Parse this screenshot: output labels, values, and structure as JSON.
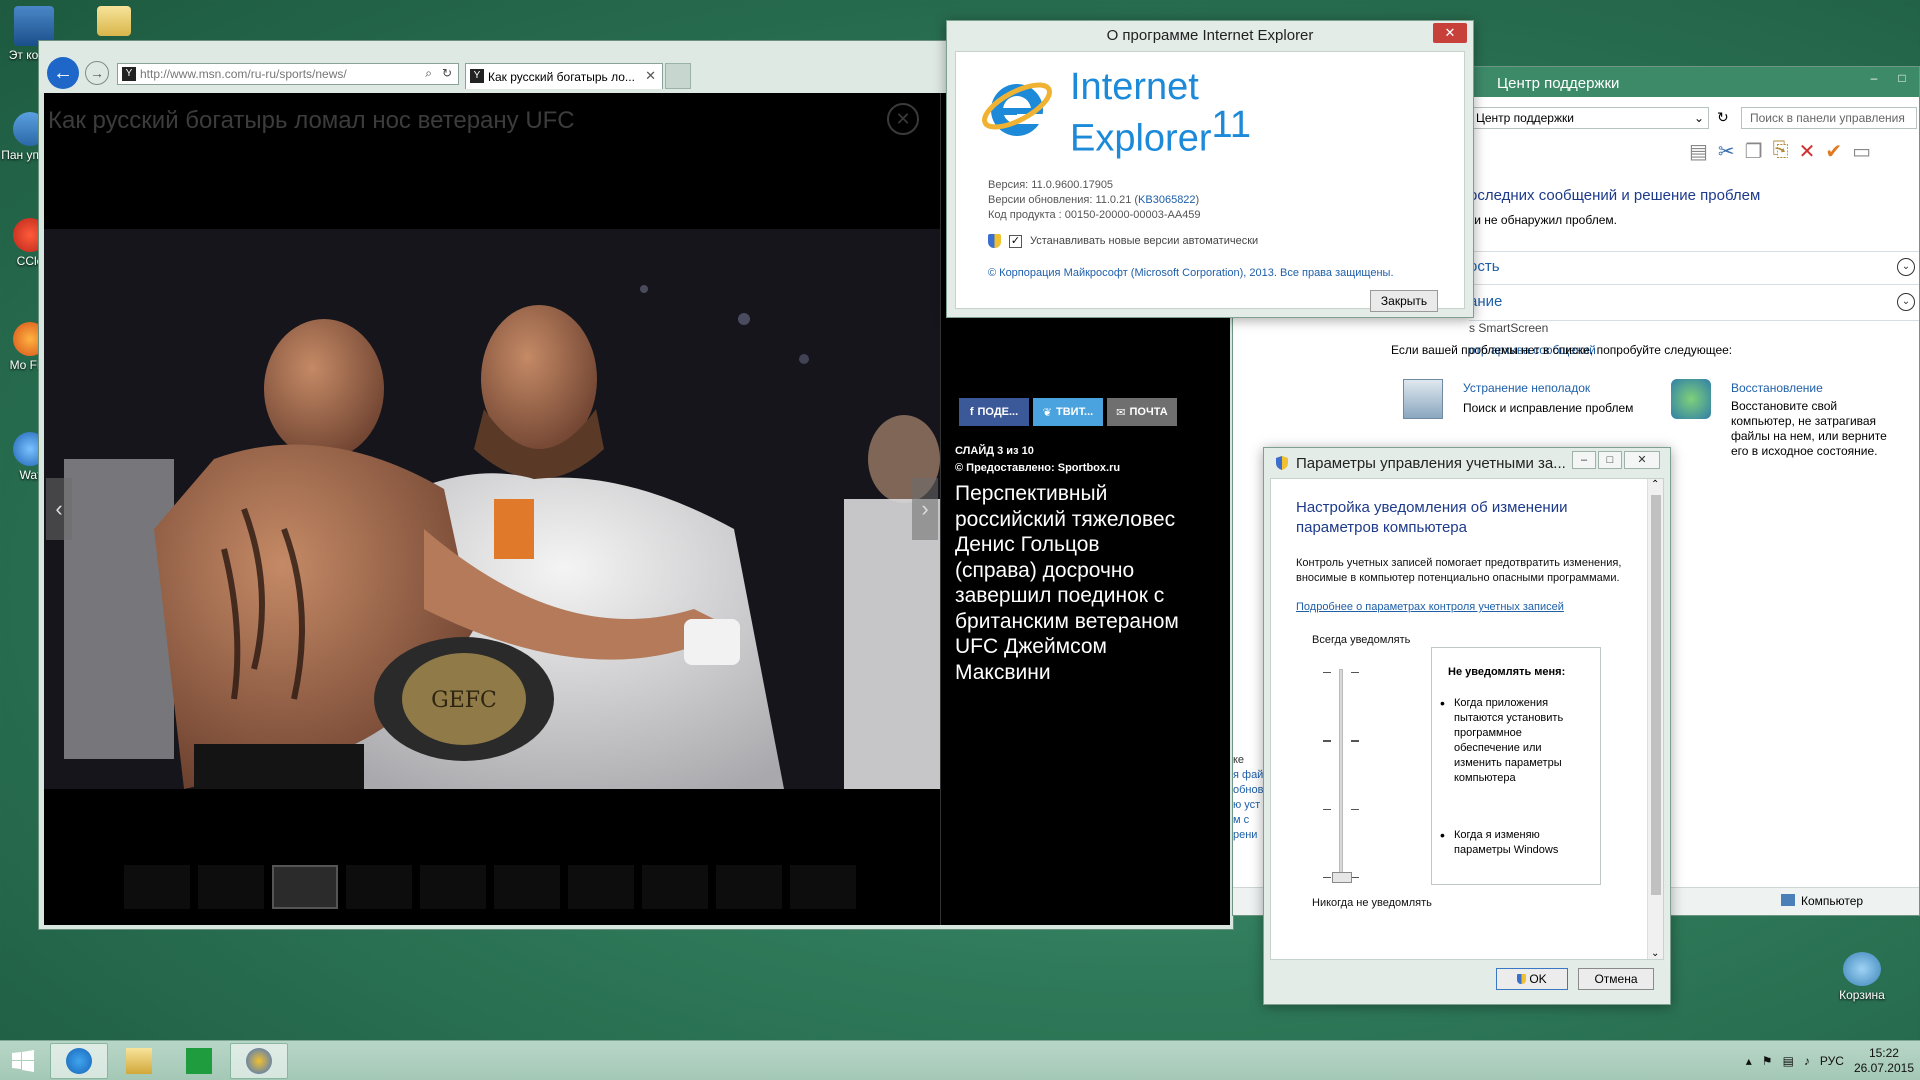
{
  "desktop": {
    "icons": [
      {
        "label": "Эт компь",
        "icon": "computer-icon"
      },
      {
        "label": "Пан управ",
        "icon": "control-panel-icon"
      },
      {
        "label": "CCle",
        "icon": "ccleaner-icon"
      },
      {
        "label": "Mo Fire",
        "icon": "firefox-icon"
      },
      {
        "label": "Wat",
        "icon": "watcher-icon"
      }
    ],
    "recycle_bin": "Корзина"
  },
  "browser": {
    "url": "http://www.msn.com/ru-ru/sports/news/",
    "tab_title": "Как русский богатырь ло...",
    "viewer": {
      "title": "Как русский богатырь ломал нос ветерану UFC",
      "share": {
        "facebook": "ПОДЕ...",
        "twitter": "ТВИТ...",
        "mail": "ПОЧТА"
      },
      "slide_counter": "СЛАЙД 3 из 10",
      "source": "© Предоставлено: Sportbox.ru",
      "caption": "Перспективный российский тяжеловес Денис Гольцов (справа) досрочно завершил поединок с британским ветераном UFC Джеймсом Максвини",
      "thumbnail_count": 10,
      "current_slide": 3,
      "belt_text": "GEFC"
    }
  },
  "about_ie": {
    "title": "О программе Internet Explorer",
    "product_line1": "Internet",
    "product_line2": "Explorer",
    "product_version_badge": "11",
    "version": "Версия: 11.0.9600.17905",
    "update_prefix": "Версии обновления: 11.0.21 (",
    "update_kb": "KB3065822",
    "update_suffix": ")",
    "product_code": "Код продукта : 00150-20000-00003-AA459",
    "auto_update": "Устанавливать новые версии автоматически",
    "auto_update_checked": true,
    "copyright": "© Корпорация Майкрософт (Microsoft Corporation), 2013. Все права защищены.",
    "close_button": "Закрыть"
  },
  "control_panel": {
    "title": "Центр поддержки",
    "address": "Центр поддержки",
    "search_placeholder": "Поиск в панели управления",
    "heading": "оследних сообщений и решение проблем",
    "no_problems": "ки не обнаружил проблем.",
    "section_security": "ость",
    "section_maintenance": "ание",
    "smartscreen": "s SmartScreen",
    "archive": "отр архива сообщений",
    "try_text": "Если вашей проблемы нет в списке, попробуйте следующее:",
    "troubleshoot_title": "Устранение неполадок",
    "troubleshoot_desc": "Поиск и исправление проблем",
    "recovery_title": "Восстановление",
    "recovery_desc": "Восстановите свой компьютер, не затрагивая файлы на нем, или верните его в исходное состояние.",
    "left_fragments": [
      "ке",
      "я фай",
      "обнов",
      "ю уст",
      "м с",
      "рени"
    ],
    "statusbar": "Компьютер"
  },
  "uac": {
    "title": "Параметры управления учетными за...",
    "heading_line1": "Настройка уведомления об изменении",
    "heading_line2": "параметров компьютера",
    "description": "Контроль учетных записей помогает предотвратить изменения, вносимые в компьютер потенциально опасными программами.",
    "link": "Подробнее о параметрах контроля учетных записей",
    "always_notify": "Всегда уведомлять",
    "never_notify": "Никогда не уведомлять",
    "box_title": "Не уведомлять меня:",
    "bullets": [
      "Когда приложения пытаются установить программное обеспечение или изменить параметры компьютера",
      "Когда я изменяю параметры Windows"
    ],
    "slider_level": 0,
    "slider_levels": 4,
    "ok": "OK",
    "cancel": "Отмена"
  },
  "taskbar": {
    "apps": [
      {
        "name": "ie-icon",
        "active": true
      },
      {
        "name": "file-explorer-icon",
        "active": false
      },
      {
        "name": "store-icon",
        "active": false
      },
      {
        "name": "uac-settings-icon",
        "active": true
      }
    ],
    "language": "РУС",
    "time": "15:22",
    "date": "26.07.2015"
  },
  "colors": {
    "accent": "#3d8a69",
    "link": "#1e5fa8",
    "ie_blue": "#1c8ad8",
    "facebook": "#3b5998",
    "twitter": "#4aa3df"
  }
}
